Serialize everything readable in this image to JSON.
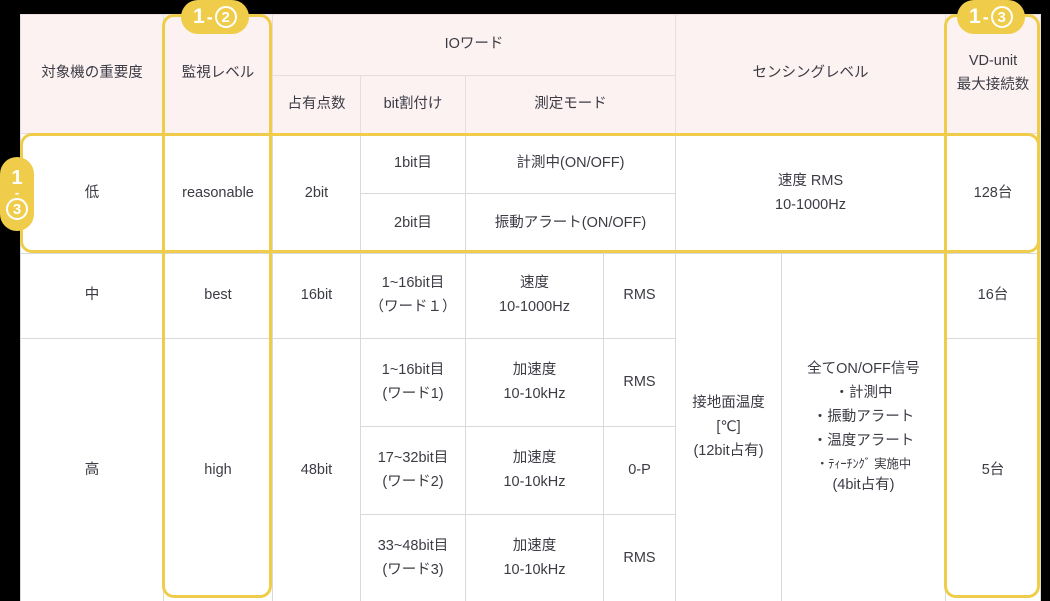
{
  "colors": {
    "accent_yellow": "#efcd4b",
    "header_bg": "#fcf2f2",
    "grid_line": "#d9d9d9",
    "text": "#3b3b44",
    "page_bg": "#000000"
  },
  "badges": [
    {
      "id": "badge-2",
      "prefix": "1",
      "dash": "-",
      "circled": "2",
      "orientation": "horizontal",
      "target": "監視レベル column"
    },
    {
      "id": "badge-3",
      "prefix": "1",
      "dash": "-",
      "circled": "3",
      "orientation": "horizontal",
      "target": "VD-unit 最大接続数 column"
    },
    {
      "id": "badge-1-3-left",
      "prefix": "1",
      "dash": "-",
      "circled": "3",
      "orientation": "vertical",
      "target": "reasonable row"
    }
  ],
  "header": {
    "col_importance": "対象機の重要度",
    "col_monitor_level": "監視レベル",
    "group_io_word": "IOワード",
    "col_points": "占有点数",
    "col_bit_assign": "bit割付け",
    "col_measure_mode": "測定モード",
    "group_sensing_level": "センシングレベル",
    "col_vd_unit_l1": "VD-unit",
    "col_vd_unit_l2": "最大接続数"
  },
  "rows": {
    "low": {
      "importance": "低",
      "monitor_level": "reasonable",
      "points": "2bit",
      "bits": [
        "1bit目",
        "2bit目"
      ],
      "modes": [
        "計測中(ON/OFF)",
        "振動アラート(ON/OFF)"
      ],
      "sensing_l1": "速度 RMS",
      "sensing_l2": "10-1000Hz",
      "vd_unit": "128台"
    },
    "mid": {
      "importance": "中",
      "monitor_level": "best",
      "points": "16bit",
      "bit_range": "1~16bit目",
      "word": "（ワード１）",
      "measure_l1": "速度",
      "measure_l2": "10-1000Hz",
      "rms": "RMS",
      "vd_unit": "16台"
    },
    "high": {
      "importance": "高",
      "monitor_level": "high",
      "points": "48bit",
      "vd_unit": "5台",
      "subrows": [
        {
          "bit_range": "1~16bit目",
          "word": "(ワード1)",
          "measure_l1": "加速度",
          "measure_l2": "10-10kHz",
          "rms": "RMS"
        },
        {
          "bit_range": "17~32bit目",
          "word": "(ワード2)",
          "measure_l1": "加速度",
          "measure_l2": "10-10kHz",
          "rms": "0-P"
        },
        {
          "bit_range": "33~48bit目",
          "word": "(ワード3)",
          "measure_l1": "加速度",
          "measure_l2": "10-10kHz",
          "rms": "RMS"
        }
      ]
    },
    "sensing_shared": {
      "temp_l1": "接地面温度",
      "temp_l2": "[℃]",
      "temp_l3": "(12bit占有)",
      "signals_l1": "全てON/OFF信号",
      "signals_l2": "・計測中",
      "signals_l3": "・振動アラート",
      "signals_l4": "・温度アラート",
      "signals_l5": "・ﾃｨｰﾁﾝｸﾞ 実施中",
      "signals_l6": "(4bit占有)"
    }
  }
}
